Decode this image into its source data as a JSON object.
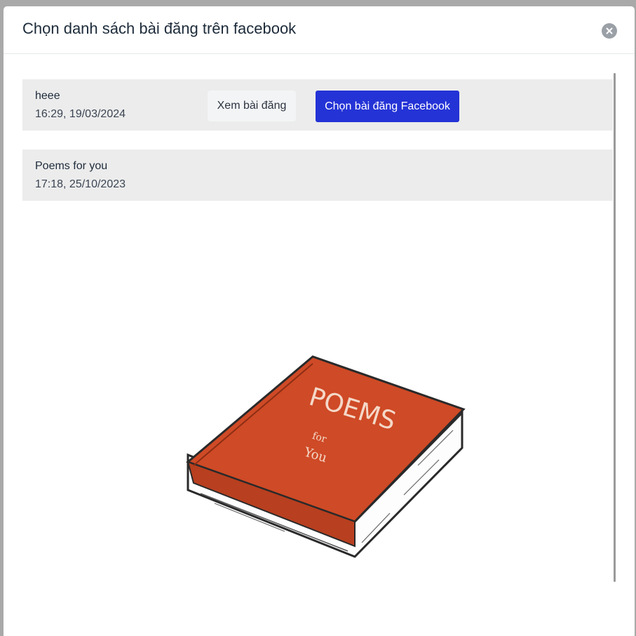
{
  "modal": {
    "title": "Chọn danh sách bài đăng trên facebook"
  },
  "posts": [
    {
      "title": "heee",
      "time": "16:29, 19/03/2024",
      "view_label": "Xem bài đăng",
      "choose_label": "Chọn bài đăng Facebook"
    },
    {
      "title": "Poems for you",
      "time": "17:18, 25/10/2023",
      "image": {
        "cover_text": "POEMS",
        "sub_text_1": "for",
        "sub_text_2": "You",
        "cover_color": "#cf4a26"
      }
    }
  ],
  "icons": {
    "close": "close-icon"
  },
  "colors": {
    "primary_button": "#2433d6",
    "item_background": "#ececec"
  }
}
